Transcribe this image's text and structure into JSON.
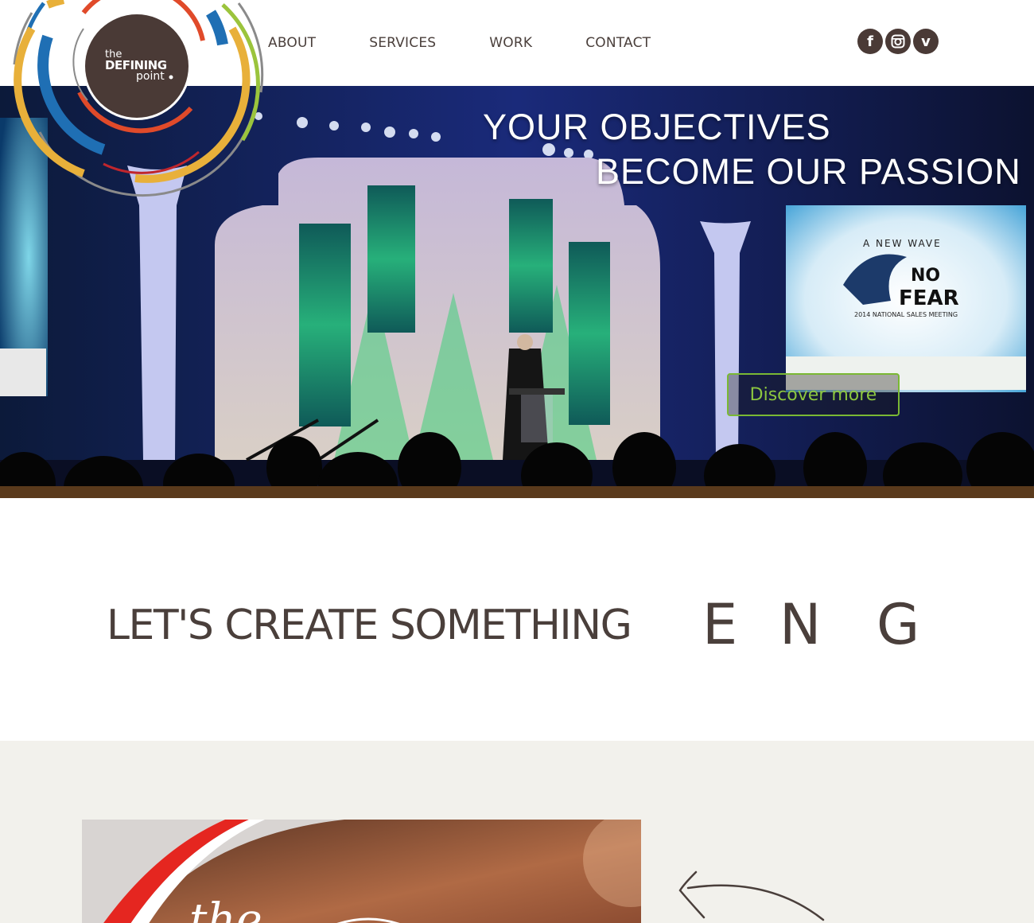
{
  "brand": {
    "line1": "the",
    "line2": "DEFINING",
    "line3": "point"
  },
  "nav": {
    "items": [
      {
        "label": "ABOUT"
      },
      {
        "label": "SERVICES"
      },
      {
        "label": "WORK"
      },
      {
        "label": "CONTACT"
      }
    ]
  },
  "social": {
    "items": [
      {
        "icon": "facebook-icon",
        "glyph": "f"
      },
      {
        "icon": "instagram-icon"
      },
      {
        "icon": "vimeo-icon",
        "glyph": "v"
      }
    ]
  },
  "hero": {
    "title_line1": "YOUR OBJECTIVES",
    "title_line2": "BECOME OUR PASSION",
    "cta_label": "Discover more",
    "screen_line1": "A NEW WAVE",
    "screen_line2": "NO",
    "screen_line3": "FEAR",
    "screen_line4": "2014 NATIONAL SALES MEETING"
  },
  "tagline": {
    "main": "LET'S CREATE SOMETHING",
    "letters": [
      "E",
      "N",
      "G"
    ]
  },
  "feature": {
    "caption": "the"
  },
  "colors": {
    "brand_brown": "#4a3a36",
    "accent_green": "#8cc63f",
    "ring_orange": "#e8b03a",
    "ring_red": "#e04a2a",
    "ring_blue": "#1f6fb4",
    "ring_lime": "#9bc43c",
    "lower_bg": "#f2f1ec"
  }
}
